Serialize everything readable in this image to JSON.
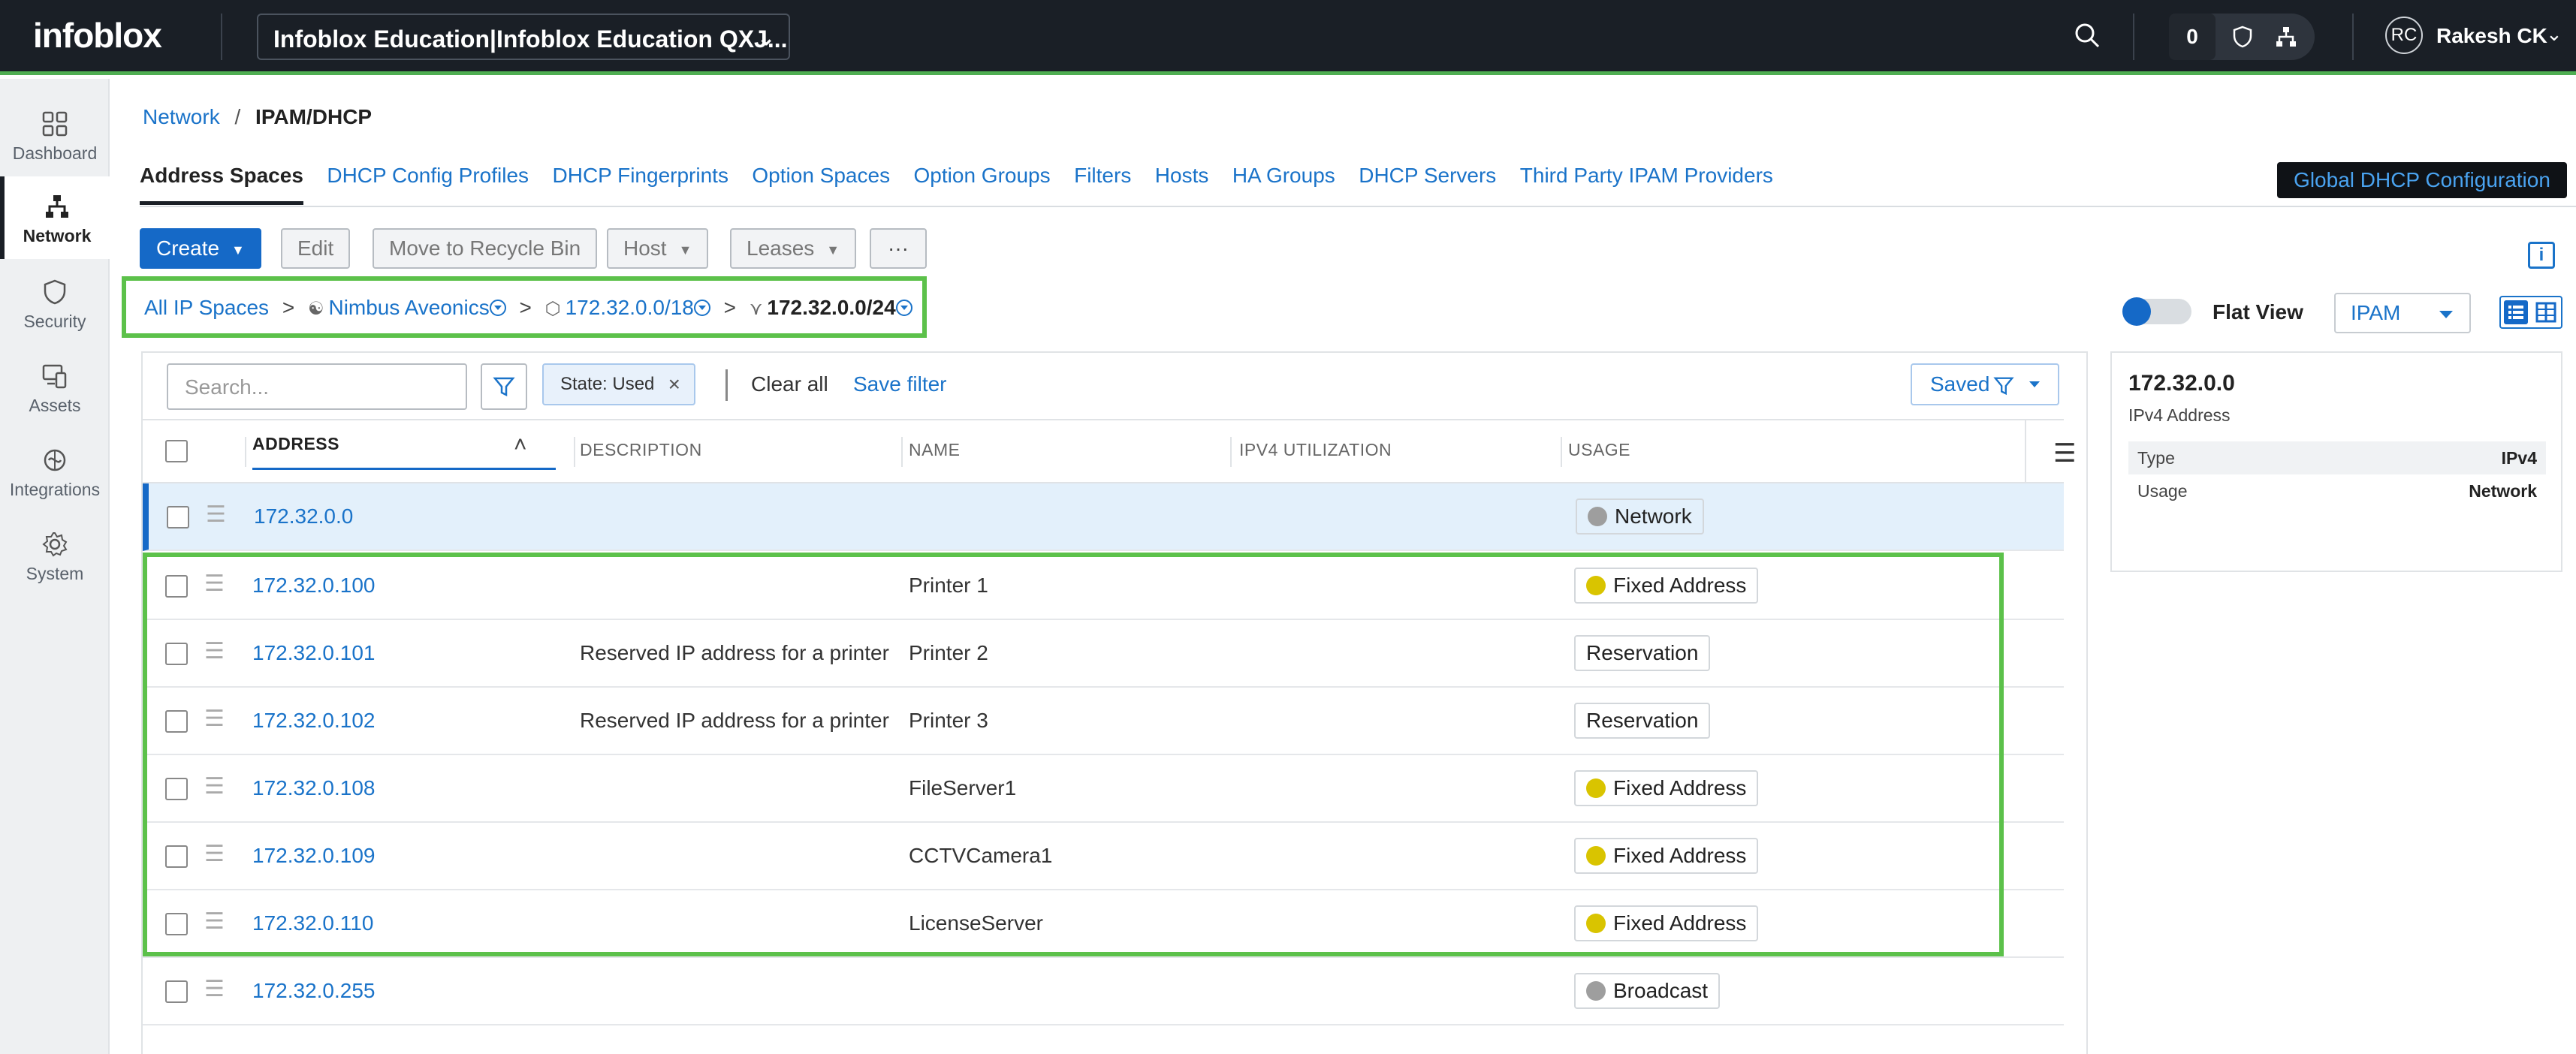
{
  "header": {
    "logo": "infoblox",
    "tenant": "Infoblox Education|Infoblox Education QXJ...",
    "notification_count": "0",
    "user_initials": "RC",
    "user_name": "Rakesh CK"
  },
  "sidenav": {
    "items": [
      {
        "label": "Dashboard",
        "icon": "dashboard-icon"
      },
      {
        "label": "Network",
        "icon": "network-icon",
        "active": true
      },
      {
        "label": "Security",
        "icon": "shield-icon"
      },
      {
        "label": "Assets",
        "icon": "assets-icon"
      },
      {
        "label": "Integrations",
        "icon": "integrations-icon"
      },
      {
        "label": "System",
        "icon": "gear-icon"
      }
    ]
  },
  "breadcrumb": {
    "parent": "Network",
    "separator": "/",
    "current": "IPAM/DHCP"
  },
  "tabs": [
    {
      "label": "Address Spaces",
      "active": true
    },
    {
      "label": "DHCP Config Profiles"
    },
    {
      "label": "DHCP Fingerprints"
    },
    {
      "label": "Option Spaces"
    },
    {
      "label": "Option Groups"
    },
    {
      "label": "Filters"
    },
    {
      "label": "Hosts"
    },
    {
      "label": "HA Groups"
    },
    {
      "label": "DHCP Servers"
    },
    {
      "label": "Third Party IPAM Providers"
    }
  ],
  "global_dhcp_button": "Global DHCP Configuration",
  "toolbar": {
    "create": "Create",
    "edit": "Edit",
    "recycle": "Move to Recycle Bin",
    "host": "Host",
    "leases": "Leases",
    "more": "···"
  },
  "hierarchy": {
    "root": "All IP Spaces",
    "space": "Nimbus Aveonics",
    "block": "172.32.0.0/18",
    "subnet": "172.32.0.0/24",
    "gt": ">"
  },
  "view": {
    "flat_view": "Flat View",
    "mode": "IPAM"
  },
  "filters": {
    "search_placeholder": "Search...",
    "chip": "State: Used",
    "clear_all": "Clear all",
    "save_filter": "Save filter",
    "saved": "Saved"
  },
  "table": {
    "columns": [
      "ADDRESS",
      "DESCRIPTION",
      "NAME",
      "IPV4 UTILIZATION",
      "USAGE"
    ],
    "rows": [
      {
        "address": "172.32.0.0",
        "description": "",
        "name": "",
        "usage": "Network",
        "usage_color": "#9e9e9e"
      },
      {
        "address": "172.32.0.100",
        "description": "",
        "name": "Printer 1",
        "usage": "Fixed Address",
        "usage_color": "#d9c400"
      },
      {
        "address": "172.32.0.101",
        "description": "Reserved IP address for a printer",
        "name": "Printer 2",
        "usage": "Reservation",
        "usage_color": ""
      },
      {
        "address": "172.32.0.102",
        "description": "Reserved IP address for a printer",
        "name": "Printer 3",
        "usage": "Reservation",
        "usage_color": ""
      },
      {
        "address": "172.32.0.108",
        "description": "",
        "name": "FileServer1",
        "usage": "Fixed Address",
        "usage_color": "#d9c400"
      },
      {
        "address": "172.32.0.109",
        "description": "",
        "name": "CCTVCamera1",
        "usage": "Fixed Address",
        "usage_color": "#d9c400"
      },
      {
        "address": "172.32.0.110",
        "description": "",
        "name": "LicenseServer",
        "usage": "Fixed Address",
        "usage_color": "#d9c400"
      },
      {
        "address": "172.32.0.255",
        "description": "",
        "name": "",
        "usage": "Broadcast",
        "usage_color": "#9e9e9e"
      }
    ]
  },
  "detail": {
    "title": "172.32.0.0",
    "subtitle": "IPv4 Address",
    "fields": [
      {
        "label": "Type",
        "value": "IPv4"
      },
      {
        "label": "Usage",
        "value": "Network"
      }
    ]
  },
  "colors": {
    "accent": "#1569c7",
    "highlight": "#5cc14a",
    "topbar": "#1a1f26"
  }
}
